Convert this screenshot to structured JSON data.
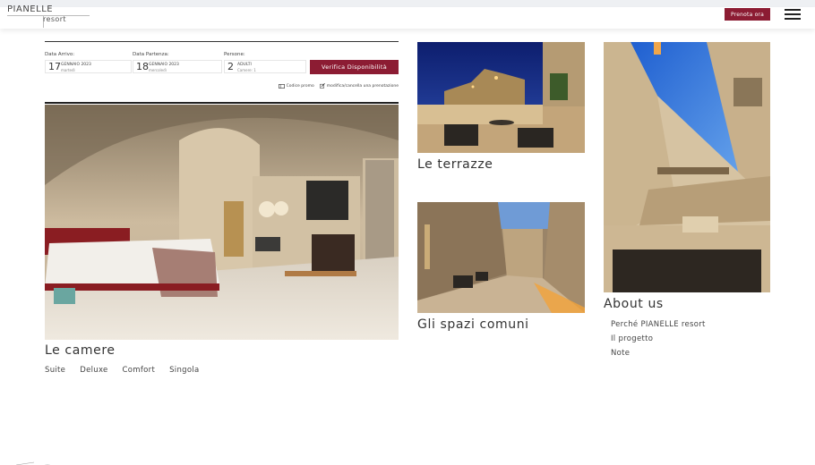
{
  "header": {
    "logo_main": "PIANELLE",
    "logo_sub": "resort",
    "book_button": "Prenota ora",
    "menu_icon": "hamburger-icon"
  },
  "booking": {
    "arrival": {
      "label": "Data Arrivo:",
      "day": "17",
      "month": "GENNAIO 2023",
      "weekday": "martedì"
    },
    "departure": {
      "label": "Data Partenza:",
      "day": "18",
      "month": "GENNAIO 2023",
      "weekday": "mercoledì"
    },
    "guests": {
      "label": "Persone:",
      "count": "2",
      "unit": "ADULTI",
      "rooms": "Camere: 1"
    },
    "verify_button": "Verifica Disponibilità",
    "promo_code": "Codice promo",
    "modify_link": "modifica/cancella una prenotazione"
  },
  "sections": {
    "rooms": {
      "title": "Le camere",
      "links": [
        "Suite",
        "Deluxe",
        "Comfort",
        "Singola"
      ]
    },
    "terraces": {
      "title": "Le terrazze"
    },
    "common": {
      "title": "Gli spazi comuni"
    },
    "about": {
      "title": "About us",
      "links": [
        "Perché PIANELLE resort",
        "Il progetto",
        "Note"
      ]
    }
  },
  "colors": {
    "accent": "#8c1c33",
    "text": "#333333"
  }
}
